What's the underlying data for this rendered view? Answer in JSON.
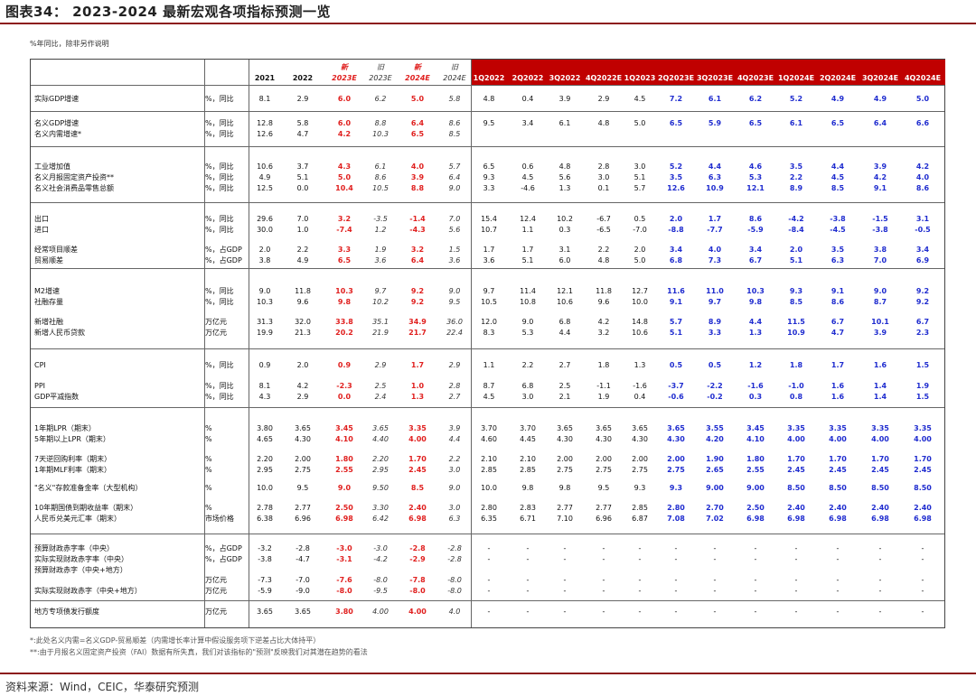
{
  "title": "图表34： 2023-2024 最新宏观各项指标预测一览",
  "unit_note": "%年同比，除非另作说明",
  "columns": {
    "annual": [
      "2021",
      "2022",
      "新",
      "旧",
      "新",
      "旧"
    ],
    "annual_sub": [
      "",
      "",
      "2023E",
      "2023E",
      "2024E",
      "2024E"
    ],
    "quarterly": [
      "1Q2022",
      "2Q2022",
      "3Q2022",
      "4Q2022E",
      "1Q2023",
      "2Q2023E",
      "3Q2023E",
      "4Q2023E",
      "1Q2024E",
      "2Q2024E",
      "3Q2024E",
      "4Q2024E"
    ]
  },
  "rows": [
    {
      "label": "实际GDP增速",
      "unit": "%，同比",
      "annual": [
        "8.1",
        "2.9",
        "6.0",
        "6.2",
        "5.0",
        "5.8"
      ],
      "q": [
        "4.8",
        "0.4",
        "3.9",
        "2.9",
        "4.5",
        "7.2",
        "6.1",
        "6.2",
        "5.2",
        "4.9",
        "4.9",
        "5.0"
      ]
    },
    {
      "label": "名义GDP增速",
      "unit": "%，同比",
      "annual": [
        "12.8",
        "5.8",
        "6.0",
        "8.8",
        "6.4",
        "8.6"
      ],
      "q": [
        "9.5",
        "3.4",
        "6.1",
        "4.8",
        "5.0",
        "6.5",
        "5.9",
        "6.5",
        "6.1",
        "6.5",
        "6.4",
        "6.6"
      ]
    },
    {
      "label": "名义内需增速*",
      "unit": "%，同比",
      "annual": [
        "12.6",
        "4.7",
        "4.2",
        "10.3",
        "6.5",
        "8.5"
      ],
      "q": []
    },
    {
      "label": "工业增加值",
      "unit": "%，同比",
      "annual": [
        "10.6",
        "3.7",
        "4.3",
        "6.1",
        "4.0",
        "5.7"
      ],
      "q": [
        "6.5",
        "0.6",
        "4.8",
        "2.8",
        "3.0",
        "5.2",
        "4.4",
        "4.6",
        "3.5",
        "4.4",
        "3.9",
        "4.2"
      ]
    },
    {
      "label": "名义月报固定资产投资**",
      "unit": "%，同比",
      "annual": [
        "4.9",
        "5.1",
        "5.0",
        "8.6",
        "3.9",
        "6.4"
      ],
      "q": [
        "9.3",
        "4.5",
        "5.6",
        "3.0",
        "5.1",
        "3.5",
        "6.3",
        "5.3",
        "2.2",
        "4.5",
        "4.2",
        "4.0"
      ]
    },
    {
      "label": "名义社会消费品零售总额",
      "unit": "%，同比",
      "annual": [
        "12.5",
        "0.0",
        "10.4",
        "10.5",
        "8.8",
        "9.0"
      ],
      "q": [
        "3.3",
        "-4.6",
        "1.3",
        "0.1",
        "5.7",
        "12.6",
        "10.9",
        "12.1",
        "8.9",
        "8.5",
        "9.1",
        "8.6"
      ]
    },
    {
      "label": "出口",
      "unit": "%，同比",
      "annual": [
        "29.6",
        "7.0",
        "3.2",
        "-3.5",
        "-1.4",
        "7.0"
      ],
      "q": [
        "15.4",
        "12.4",
        "10.2",
        "-6.7",
        "0.5",
        "2.0",
        "1.7",
        "8.6",
        "-4.2",
        "-3.8",
        "-1.5",
        "3.1"
      ]
    },
    {
      "label": "进口",
      "unit": "%，同比",
      "annual": [
        "30.0",
        "1.0",
        "-7.4",
        "1.2",
        "-4.3",
        "5.6"
      ],
      "q": [
        "10.7",
        "1.1",
        "0.3",
        "-6.5",
        "-7.0",
        "-8.8",
        "-7.7",
        "-5.9",
        "-8.4",
        "-4.5",
        "-3.8",
        "-0.5"
      ]
    },
    {
      "label": "经常项目顺差",
      "unit": "%，占GDP",
      "annual": [
        "2.0",
        "2.2",
        "3.3",
        "1.9",
        "3.2",
        "1.5"
      ],
      "q": [
        "1.7",
        "1.7",
        "3.1",
        "2.2",
        "2.0",
        "3.4",
        "4.0",
        "3.4",
        "2.0",
        "3.5",
        "3.8",
        "3.4"
      ]
    },
    {
      "label": "贸易顺差",
      "unit": "%，占GDP",
      "annual": [
        "3.8",
        "4.9",
        "6.5",
        "3.6",
        "6.4",
        "3.6"
      ],
      "q": [
        "3.6",
        "5.1",
        "6.0",
        "4.8",
        "5.0",
        "6.8",
        "7.3",
        "6.7",
        "5.1",
        "6.3",
        "7.0",
        "6.9"
      ]
    },
    {
      "label": "M2增速",
      "unit": "%，同比",
      "annual": [
        "9.0",
        "11.8",
        "10.3",
        "9.7",
        "9.2",
        "9.0"
      ],
      "q": [
        "9.7",
        "11.4",
        "12.1",
        "11.8",
        "12.7",
        "11.6",
        "11.0",
        "10.3",
        "9.3",
        "9.1",
        "9.0",
        "9.2"
      ]
    },
    {
      "label": "社融存量",
      "unit": "%，同比",
      "annual": [
        "10.3",
        "9.6",
        "9.8",
        "10.2",
        "9.2",
        "9.5"
      ],
      "q": [
        "10.5",
        "10.8",
        "10.6",
        "9.6",
        "10.0",
        "9.1",
        "9.7",
        "9.8",
        "8.5",
        "8.6",
        "8.7",
        "9.2"
      ]
    },
    {
      "label": "新增社融",
      "unit": "万亿元",
      "annual": [
        "31.3",
        "32.0",
        "33.8",
        "35.1",
        "34.9",
        "36.0"
      ],
      "q": [
        "12.0",
        "9.0",
        "6.8",
        "4.2",
        "14.8",
        "5.7",
        "8.9",
        "4.4",
        "11.5",
        "6.7",
        "10.1",
        "6.7"
      ]
    },
    {
      "label": "新增人民币贷款",
      "unit": "万亿元",
      "annual": [
        "19.9",
        "21.3",
        "20.2",
        "21.9",
        "21.7",
        "22.4"
      ],
      "q": [
        "8.3",
        "5.3",
        "4.4",
        "3.2",
        "10.6",
        "5.1",
        "3.3",
        "1.3",
        "10.9",
        "4.7",
        "3.9",
        "2.3"
      ]
    },
    {
      "label": "CPI",
      "unit": "%，同比",
      "annual": [
        "0.9",
        "2.0",
        "0.9",
        "2.9",
        "1.7",
        "2.9"
      ],
      "q": [
        "1.1",
        "2.2",
        "2.7",
        "1.8",
        "1.3",
        "0.5",
        "0.5",
        "1.2",
        "1.8",
        "1.7",
        "1.6",
        "1.5"
      ]
    },
    {
      "label": "PPI",
      "unit": "%，同比",
      "annual": [
        "8.1",
        "4.2",
        "-2.3",
        "2.5",
        "1.0",
        "2.8"
      ],
      "q": [
        "8.7",
        "6.8",
        "2.5",
        "-1.1",
        "-1.6",
        "-3.7",
        "-2.2",
        "-1.6",
        "-1.0",
        "1.6",
        "1.4",
        "1.9"
      ]
    },
    {
      "label": "GDP平减指数",
      "unit": "%，同比",
      "annual": [
        "4.3",
        "2.9",
        "0.0",
        "2.4",
        "1.3",
        "2.7"
      ],
      "q": [
        "4.5",
        "3.0",
        "2.1",
        "1.9",
        "0.4",
        "-0.6",
        "-0.2",
        "0.3",
        "0.8",
        "1.6",
        "1.4",
        "1.5"
      ]
    },
    {
      "label": "1年期LPR（期末）",
      "unit": "%",
      "annual": [
        "3.80",
        "3.65",
        "3.45",
        "3.65",
        "3.35",
        "3.9"
      ],
      "q": [
        "3.70",
        "3.70",
        "3.65",
        "3.65",
        "3.65",
        "3.65",
        "3.55",
        "3.45",
        "3.35",
        "3.35",
        "3.35",
        "3.35"
      ]
    },
    {
      "label": "5年期以上LPR（期末）",
      "unit": "%",
      "annual": [
        "4.65",
        "4.30",
        "4.10",
        "4.40",
        "4.00",
        "4.4"
      ],
      "q": [
        "4.60",
        "4.45",
        "4.30",
        "4.30",
        "4.30",
        "4.30",
        "4.20",
        "4.10",
        "4.00",
        "4.00",
        "4.00",
        "4.00"
      ]
    },
    {
      "label": "7天逆回购利率（期末）",
      "unit": "%",
      "annual": [
        "2.20",
        "2.00",
        "1.80",
        "2.20",
        "1.70",
        "2.2"
      ],
      "q": [
        "2.10",
        "2.10",
        "2.00",
        "2.00",
        "2.00",
        "2.00",
        "1.90",
        "1.80",
        "1.70",
        "1.70",
        "1.70",
        "1.70"
      ]
    },
    {
      "label": "1年期MLF利率（期末）",
      "unit": "%",
      "annual": [
        "2.95",
        "2.75",
        "2.55",
        "2.95",
        "2.45",
        "3.0"
      ],
      "q": [
        "2.85",
        "2.85",
        "2.75",
        "2.75",
        "2.75",
        "2.75",
        "2.65",
        "2.55",
        "2.45",
        "2.45",
        "2.45",
        "2.45"
      ]
    },
    {
      "label": "\"名义\"存款准备金率（大型机构）",
      "unit": "%",
      "annual": [
        "10.0",
        "9.5",
        "9.0",
        "9.50",
        "8.5",
        "9.0"
      ],
      "q": [
        "10.0",
        "9.8",
        "9.8",
        "9.5",
        "9.3",
        "9.3",
        "9.00",
        "9.00",
        "8.50",
        "8.50",
        "8.50",
        "8.50"
      ]
    },
    {
      "label": "10年期国债到期收益率（期末）",
      "unit": "%",
      "annual": [
        "2.78",
        "2.77",
        "2.50",
        "3.30",
        "2.40",
        "3.0"
      ],
      "q": [
        "2.80",
        "2.83",
        "2.77",
        "2.77",
        "2.85",
        "2.80",
        "2.70",
        "2.50",
        "2.40",
        "2.40",
        "2.40",
        "2.40"
      ]
    },
    {
      "label": "人民币兑美元汇率（期末）",
      "unit": "市场价格",
      "annual": [
        "6.38",
        "6.96",
        "6.98",
        "6.42",
        "6.98",
        "6.3"
      ],
      "q": [
        "6.35",
        "6.71",
        "7.10",
        "6.96",
        "6.87",
        "7.08",
        "7.02",
        "6.98",
        "6.98",
        "6.98",
        "6.98",
        "6.98"
      ]
    },
    {
      "label": "预算财政赤字率（中央）",
      "unit": "%，占GDP",
      "annual": [
        "-3.2",
        "-2.8",
        "-3.0",
        "-3.0",
        "-2.8",
        "-2.8"
      ],
      "q": [
        "-",
        "-",
        "-",
        "-",
        "-",
        "-",
        "-",
        "-",
        "-",
        "-",
        "-",
        "-"
      ]
    },
    {
      "label": "实际实现财政赤字率（中央）",
      "unit": "%，占GDP",
      "annual": [
        "-3.8",
        "-4.7",
        "-3.1",
        "-4.2",
        "-2.9",
        "-2.8"
      ],
      "q": [
        "-",
        "-",
        "-",
        "-",
        "-",
        "-",
        "-",
        "-",
        "-",
        "-",
        "-",
        "-"
      ]
    },
    {
      "label": "预算财政赤字（中央+地方）",
      "unit": "",
      "annual": [
        "",
        "",
        "",
        "",
        "",
        ""
      ],
      "q": []
    },
    {
      "label": "",
      "unit": "万亿元",
      "annual": [
        "-7.3",
        "-7.0",
        "-7.6",
        "-8.0",
        "-7.8",
        "-8.0"
      ],
      "q": [
        "-",
        "-",
        "-",
        "-",
        "-",
        "-",
        "-",
        "-",
        "-",
        "-",
        "-",
        "-"
      ]
    },
    {
      "label": "实际实现财政赤字（中央+地方）",
      "unit": "万亿元",
      "annual": [
        "-5.9",
        "-9.0",
        "-8.0",
        "-9.5",
        "-8.0",
        "-8.0"
      ],
      "q": [
        "-",
        "-",
        "-",
        "-",
        "-",
        "-",
        "-",
        "-",
        "-",
        "-",
        "-",
        "-"
      ]
    },
    {
      "label": "地方专项债发行额度",
      "unit": "万亿元",
      "annual": [
        "3.65",
        "3.65",
        "3.80",
        "4.00",
        "4.00",
        "4.0"
      ],
      "q": [
        "-",
        "-",
        "-",
        "-",
        "-",
        "-",
        "-",
        "-",
        "-",
        "-",
        "-",
        "-"
      ]
    }
  ],
  "footnotes": [
    "*:此处名义内需=名义GDP-贸易顺差（内需增长率计算中假设服务项下逆差占比大体持平）",
    "**:由于月报名义固定资产投资（FAI）数据有所失真，我们对该指标的\"预测\"反映我们对其潜在趋势的看法"
  ],
  "source": "资料来源：Wind，CEIC，华泰研究预测"
}
